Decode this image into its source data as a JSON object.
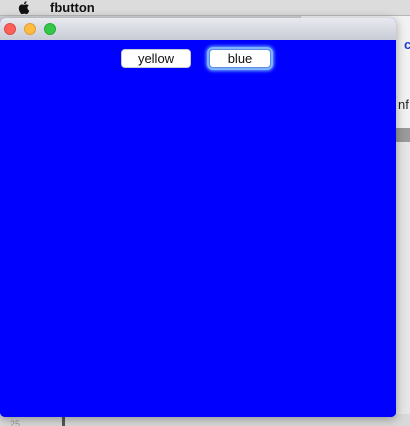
{
  "menubar": {
    "app_name": "fbutton"
  },
  "background": {
    "fragment_top": "c",
    "fragment_mid": "nf",
    "fragment_bottom": "25"
  },
  "window": {
    "buttons": [
      {
        "label": "yellow"
      },
      {
        "label": "blue",
        "focused": true
      }
    ],
    "content_color": "#0000ff"
  }
}
